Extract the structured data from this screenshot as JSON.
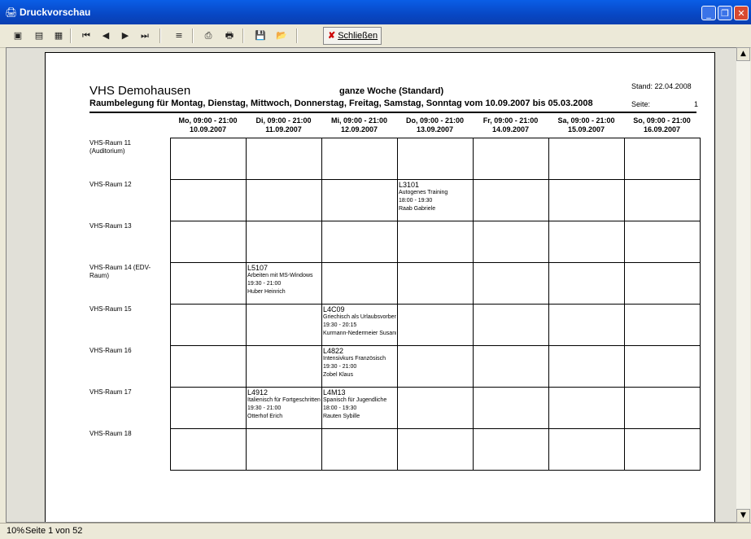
{
  "window": {
    "title": "Druckvorschau",
    "app_icon": "printer-app-icon"
  },
  "toolbar": {
    "buttons": [
      "single-page-icon",
      "multi-page-icon",
      "zoom-page-icon",
      "first-page-icon",
      "previous-page-icon",
      "next-page-icon",
      "last-page-icon",
      "goto-page-icon",
      "print-setup-icon",
      "print-icon",
      "save-icon",
      "open-icon"
    ],
    "close_label": "Schließen"
  },
  "report": {
    "org": "VHS Demohausen",
    "week_name": "ganze Woche (Standard)",
    "stand_label": "Stand:",
    "stand_date": "22.04.2008",
    "subtitle": "Raumbelegung für Montag, Dienstag, Mittwoch, Donnerstag, Freitag, Samstag, Sonntag vom 10.09.2007 bis 05.03.2008",
    "seite_label": "Seite:",
    "seite_num": "1",
    "days": [
      {
        "line1": "Mo, 09:00 - 21:00",
        "line2": "10.09.2007"
      },
      {
        "line1": "Di, 09:00 - 21:00",
        "line2": "11.09.2007"
      },
      {
        "line1": "Mi, 09:00 - 21:00",
        "line2": "12.09.2007"
      },
      {
        "line1": "Do, 09:00 - 21:00",
        "line2": "13.09.2007"
      },
      {
        "line1": "Fr, 09:00 - 21:00",
        "line2": "14.09.2007"
      },
      {
        "line1": "Sa, 09:00 - 21:00",
        "line2": "15.09.2007"
      },
      {
        "line1": "So, 09:00 - 21:00",
        "line2": "16.09.2007"
      }
    ],
    "rooms": [
      "VHS-Raum 11 (Auditorium)",
      "VHS-Raum 12",
      "VHS-Raum 13",
      "VHS-Raum 14 (EDV-Raum)",
      "VHS-Raum 15",
      "VHS-Raum 16",
      "VHS-Raum 17",
      "VHS-Raum 18"
    ],
    "events": [
      {
        "room": 1,
        "day": 3,
        "code": "L3101",
        "title": "Autogenes Training",
        "time": "18:00 - 19:30",
        "teacher": "Raab Gabriele"
      },
      {
        "room": 3,
        "day": 1,
        "code": "L5107",
        "title": "Arbeiten mit MS-Windows",
        "time": "19:30 - 21:00",
        "teacher": "Huber Heinrich"
      },
      {
        "room": 4,
        "day": 2,
        "code": "L4C09",
        "title": "Griechisch als Urlaubsvorbereitung",
        "time": "19:30 - 20:15",
        "teacher": "Kurmann-Nedermeier Susanne"
      },
      {
        "room": 5,
        "day": 2,
        "code": "L4822",
        "title": "Intensivkurs Französisch",
        "time": "19:30 - 21:00",
        "teacher": "Zobel Klaus"
      },
      {
        "room": 6,
        "day": 1,
        "code": "L4912",
        "title": "Italienisch für Fortgeschrittene",
        "time": "19:30 - 21:00",
        "teacher": "Otterhof Erich"
      },
      {
        "room": 6,
        "day": 2,
        "code": "L4M13",
        "title": "Spanisch für Jugendliche",
        "time": "18:00 - 19:30",
        "teacher": "Rauten Sybille"
      }
    ]
  },
  "status": {
    "zoom": "10%",
    "page": "Seite 1 von 52"
  }
}
